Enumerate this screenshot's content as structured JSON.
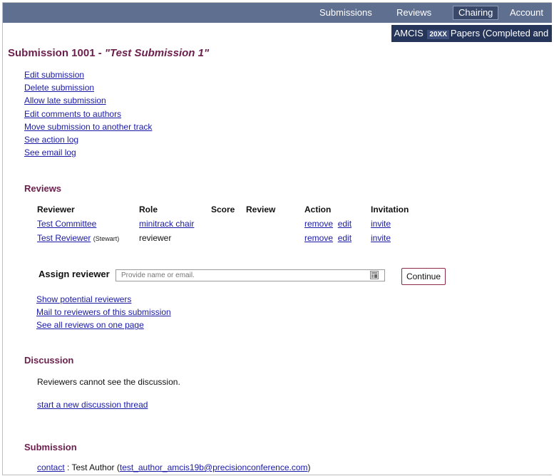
{
  "nav": {
    "submissions": "Submissions",
    "reviews": "Reviews",
    "chairing": "Chairing",
    "account": "Account"
  },
  "subnav": {
    "prefix": "AMCIS",
    "badge": "20XX",
    "suffix": "Papers (Completed and ..."
  },
  "page": {
    "title_prefix": "Submission 1001 - ",
    "title_name": "\"Test Submission 1\""
  },
  "actions": [
    "Edit submission",
    "Delete submission",
    "Allow late submission",
    "Edit comments to authors",
    "Move submission to another track",
    "See action log",
    "See email log"
  ],
  "reviews": {
    "heading": "Reviews",
    "columns": [
      "Reviewer",
      "Role",
      "Score",
      "Review",
      "Action",
      "Invitation"
    ],
    "rows": [
      {
        "reviewer": "Test Committee",
        "reviewer_note": "",
        "role": "minitrack chair",
        "score": "",
        "review": "",
        "remove": "remove",
        "edit": "edit",
        "invite": "invite"
      },
      {
        "reviewer": "Test Reviewer",
        "reviewer_note": "(Stewart)",
        "role": "reviewer",
        "score": "",
        "review": "",
        "remove": "remove",
        "edit": "edit",
        "invite": "invite"
      }
    ],
    "assign_label": "Assign reviewer",
    "assign_placeholder": "Provide name or email.",
    "continue_label": "Continue",
    "links": [
      "Show potential reviewers",
      "Mail to reviewers of this submission",
      "See all reviews on one page"
    ]
  },
  "discussion": {
    "heading": "Discussion",
    "note": "Reviewers cannot see the discussion.",
    "new_thread": "start a new discussion thread"
  },
  "submission": {
    "heading": "Submission",
    "contact_label": "contact",
    "author": " : Test Author (",
    "email": "test_author_amcis19b@precisionconference.com",
    "close": ")"
  }
}
